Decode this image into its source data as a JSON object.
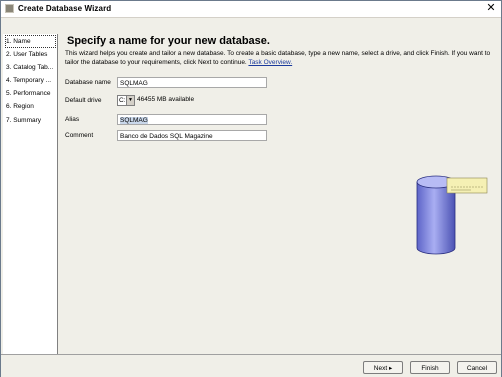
{
  "window": {
    "title": "Create Database Wizard",
    "close_glyph": "✕"
  },
  "steps": [
    {
      "label": "1. Name",
      "active": true
    },
    {
      "label": "2. User Tables"
    },
    {
      "label": "3. Catalog Tab..."
    },
    {
      "label": "4. Temporary ..."
    },
    {
      "label": "5. Performance"
    },
    {
      "label": "6. Region"
    },
    {
      "label": "7. Summary"
    }
  ],
  "main": {
    "heading": "Specify a name for your new database.",
    "description": "This wizard helps you create and tailor a new database. To create a basic database, type a new name, select a drive, and click Finish. If you want to tailor the database to your requirements, click Next to continue.",
    "task_link": "Task Overview."
  },
  "form": {
    "db_name_label": "Database name",
    "db_name_value": "SQLMAG",
    "drive_label": "Default drive",
    "drive_value": "C:",
    "drive_available": "46455 MB available",
    "alias_label": "Alias",
    "alias_value": "SQLMAG",
    "comment_label": "Comment",
    "comment_value": "Banco de Dados SQL Magazine"
  },
  "buttons": {
    "next": "Next ▸",
    "finish": "Finish",
    "cancel": "Cancel"
  },
  "icons": {
    "app": "wizard-icon",
    "illustration": "database-cylinder-icon"
  },
  "colors": {
    "accent": "#1a3a9c",
    "cylinder": "#7f86e6",
    "tag": "#f5f0b4"
  }
}
